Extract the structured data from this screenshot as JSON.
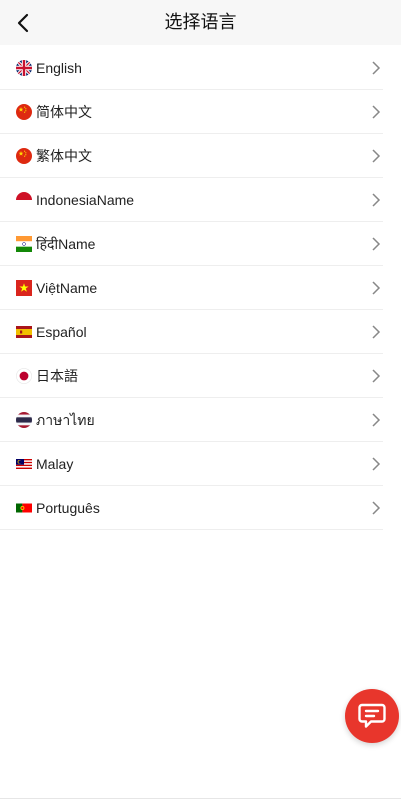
{
  "header": {
    "title": "选择语言",
    "back_icon": "chevron-left-icon"
  },
  "languages": [
    {
      "label": "English",
      "flag": "uk-flag-icon"
    },
    {
      "label": "简体中文",
      "flag": "china-flag-icon"
    },
    {
      "label": "繁体中文",
      "flag": "china-flag-icon"
    },
    {
      "label": "IndonesiaName",
      "flag": "indonesia-flag-icon"
    },
    {
      "label": "हिंदीName",
      "flag": "india-flag-icon"
    },
    {
      "label": "ViệtName",
      "flag": "vietnam-flag-icon"
    },
    {
      "label": "Español",
      "flag": "spain-flag-icon"
    },
    {
      "label": "日本語",
      "flag": "japan-flag-icon"
    },
    {
      "label": "ภาษาไทย",
      "flag": "thailand-flag-icon"
    },
    {
      "label": "Malay",
      "flag": "malaysia-flag-icon"
    },
    {
      "label": "Português",
      "flag": "portugal-flag-icon"
    }
  ],
  "chat_button": {
    "icon": "chat-bubble-icon",
    "color": "#e8362c"
  }
}
